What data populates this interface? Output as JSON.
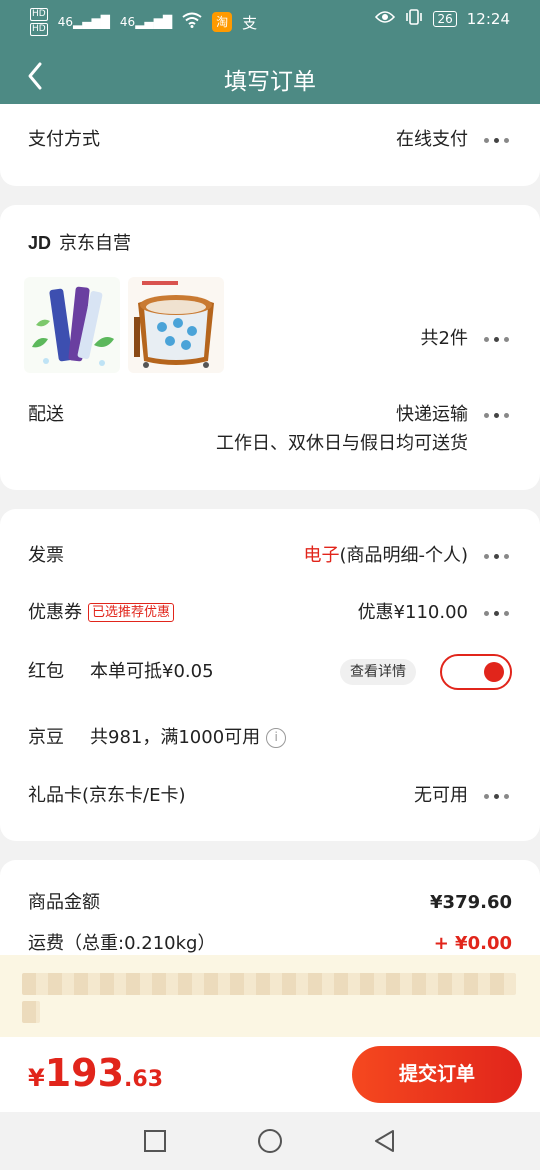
{
  "status_bar": {
    "hd1": "HD",
    "hd2": "HD",
    "signal1": "46",
    "signal2": "46",
    "app_badge": "淘",
    "alipay": "支",
    "battery": "26",
    "time": "12:24"
  },
  "header": {
    "title": "填写订单"
  },
  "payment": {
    "label": "支付方式",
    "value": "在线支付"
  },
  "shop": {
    "logo": "JD",
    "name": "京东自营",
    "count": "共2件",
    "delivery_label": "配送",
    "delivery_value": "快递运输",
    "delivery_note": "工作日、双休日与假日均可送货"
  },
  "invoice": {
    "label": "发票",
    "value_highlight": "电子",
    "value_rest": "(商品明细-个人)"
  },
  "coupon": {
    "label": "优惠券",
    "tag": "已选推荐优惠",
    "value": "优惠¥110.00"
  },
  "red_packet": {
    "label": "红包",
    "desc": "本单可抵¥0.05",
    "detail_button": "查看详情",
    "toggle_on": true
  },
  "jd_beans": {
    "label": "京豆",
    "desc": "共981，满1000可用",
    "info_icon": "i"
  },
  "gift_card": {
    "label": "礼品卡(京东卡/E卡)",
    "value": "无可用"
  },
  "summary": {
    "goods_label": "商品金额",
    "goods_value": "¥379.60",
    "shipping_label": "运费（总重:0.210kg）",
    "shipping_value": "+ ¥0.00"
  },
  "bottom": {
    "currency": "¥",
    "total_int": "193",
    "total_dec": ".63",
    "submit_label": "提交订单"
  },
  "icons": {
    "back": "back-arrow-icon",
    "more": "more-dots-icon",
    "nav_back": "triangle-back-icon",
    "nav_home": "circle-home-icon",
    "nav_recent": "square-recent-icon"
  },
  "colors": {
    "header_bg": "#4d8a84",
    "accent_red": "#e1251b",
    "notice_bg": "#fbf6e3"
  }
}
